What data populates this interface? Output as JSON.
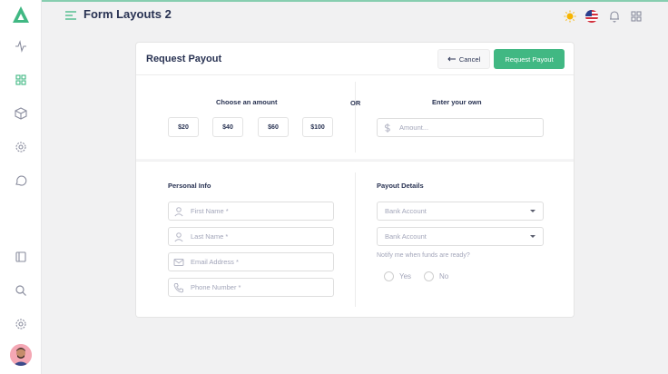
{
  "header": {
    "title": "Form Layouts 2"
  },
  "card": {
    "title": "Request Payout",
    "cancel_label": "Cancel",
    "submit_label": "Request Payout"
  },
  "amount": {
    "choose_label": "Choose an amount",
    "or_label": "OR",
    "own_label": "Enter your own",
    "options": [
      "$20",
      "$40",
      "$60",
      "$100"
    ],
    "own_placeholder": "Amount..."
  },
  "personal": {
    "title": "Personal Info",
    "first_name_placeholder": "First Name *",
    "last_name_placeholder": "Last Name *",
    "email_placeholder": "Email Address *",
    "phone_placeholder": "Phone Number *"
  },
  "payout": {
    "title": "Payout Details",
    "select1_value": "Bank Account",
    "select2_value": "Bank Account",
    "notify_label": "Notify me when funds are ready?",
    "yes_label": "Yes",
    "no_label": "No"
  },
  "colors": {
    "accent": "#41b883",
    "text": "#283252",
    "muted": "#a2a5b9"
  },
  "icons": {
    "sidebar": [
      "activity-icon",
      "grid-icon",
      "box-icon",
      "settings-icon",
      "message-icon",
      "sidebar-icon",
      "search-icon",
      "gear-icon"
    ],
    "header": [
      "sun-icon",
      "us-flag-icon",
      "bell-icon",
      "apps-grid-icon"
    ]
  }
}
